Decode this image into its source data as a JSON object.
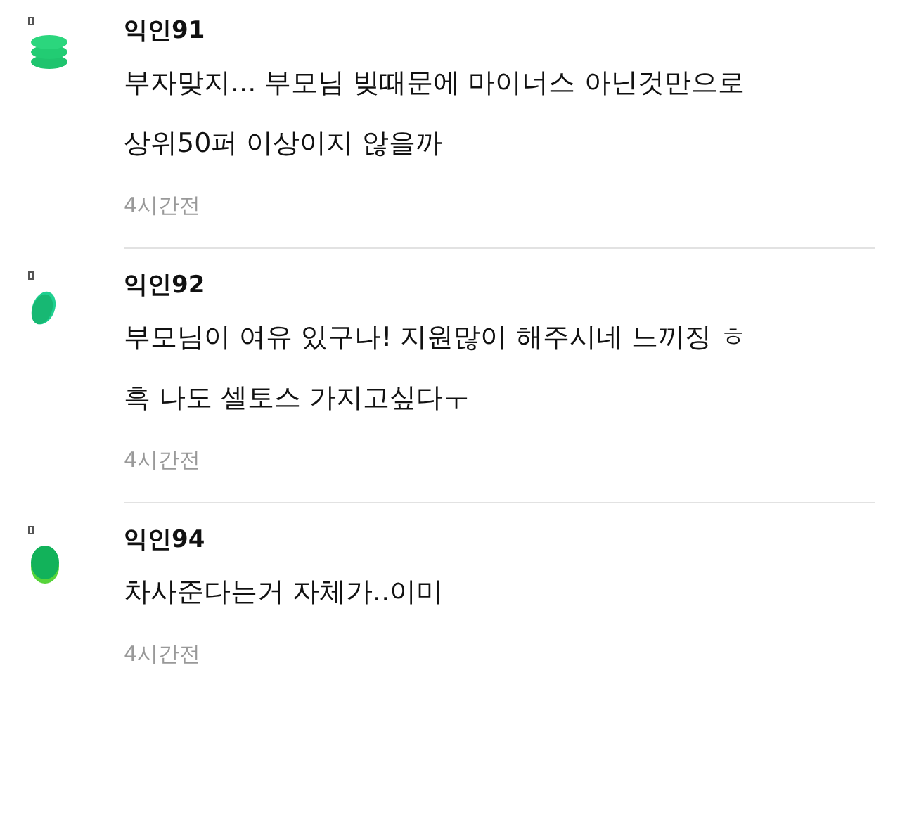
{
  "comments": [
    {
      "kind": "stack",
      "author": "익인91",
      "lines": [
        "부자맞지... 부모님 빚때문에 마이너스 아닌것만으로",
        "상위50퍼 이상이지 않을까"
      ],
      "time": "4시간전"
    },
    {
      "kind": "tilted",
      "author": "익인92",
      "lines": [
        "부모님이 여유 있구나! 지원많이 해주시네 느끼징 ㅎ",
        "흑 나도 셀토스 가지고싶다ㅜ"
      ],
      "time": "4시간전"
    },
    {
      "kind": "layered",
      "author": "익인94",
      "lines": [
        "차사준다는거 자체가..이미"
      ],
      "time": "4시간전"
    }
  ]
}
